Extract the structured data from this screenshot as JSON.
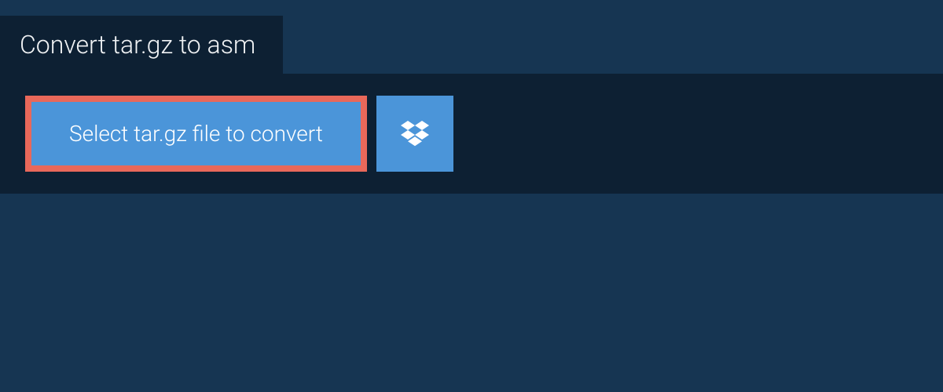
{
  "header": {
    "title": "Convert tar.gz to asm"
  },
  "actions": {
    "select_file_label": "Select tar.gz file to convert"
  }
}
